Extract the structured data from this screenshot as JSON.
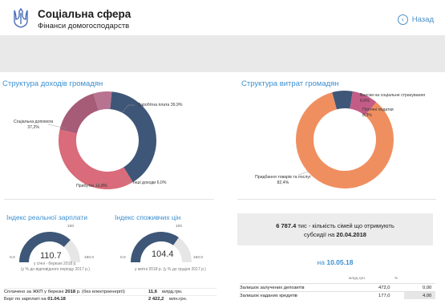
{
  "header": {
    "title": "Соціальна сфера",
    "subtitle": "Фінанси домогосподарств",
    "back_label": "Назад",
    "back_icon": "‹",
    "emblem": "trident-icon"
  },
  "colors": {
    "accent": "#3b8fd0",
    "income_navy": "#3e5778",
    "income_pink": "#d96b7a",
    "income_plum": "#a65b77",
    "expense_orange": "#ef8f5f",
    "expense_plum": "#c35c86",
    "expense_navy": "#3e5778",
    "gauge_fill": "#3e5778",
    "gauge_track": "#e6e6e6"
  },
  "income": {
    "title": "Структура доходів громадян",
    "labels": [
      {
        "name": "Заробітна плата",
        "value": "39,9%"
      },
      {
        "name": "Соціальна допомога",
        "value": "37,2%"
      },
      {
        "name": "Прибуток",
        "value": "16,8%"
      },
      {
        "name": "Інші доходи",
        "value": "6,0%"
      }
    ]
  },
  "expenses": {
    "title": "Структура витрат громадян",
    "labels": [
      {
        "name": "Внески на соціальне страхування",
        "value": "6,6%"
      },
      {
        "name": "Поточні податки",
        "value": "8,3%"
      },
      {
        "name": "Придбання товарів та послуг",
        "value": "82,4%"
      }
    ]
  },
  "chart_data": [
    {
      "type": "pie",
      "title": "Структура доходів громадян",
      "categories": [
        "Заробітна плата",
        "Соціальна допомога",
        "Прибуток",
        "Інші доходи"
      ],
      "values": [
        39.9,
        37.2,
        16.8,
        6.0
      ],
      "colors": [
        "#3e5778",
        "#d96b7a",
        "#a65b77",
        "#b77390"
      ]
    },
    {
      "type": "pie",
      "title": "Структура витрат громадян",
      "categories": [
        "Внески на соціальне страхування",
        "Поточні податки",
        "Придбання товарів та послуг"
      ],
      "values": [
        6.6,
        8.3,
        82.4
      ],
      "colors": [
        "#3e5778",
        "#c35c86",
        "#ef8f5f"
      ]
    }
  ],
  "wage_index": {
    "title": "Індекс реальної зарплати",
    "value": "110.7",
    "level": 110.7,
    "min_label": "0.0",
    "mid_label": "100",
    "max_label": "150.0",
    "caption_line1": "у січні - березні 2018 р.",
    "caption_line2": "(у % до відповідного періоду 2017 р.)"
  },
  "cpi": {
    "title": "Індекс споживчих цін",
    "value": "104.4",
    "level": 104.4,
    "min_label": "0.0",
    "mid_label": "100",
    "max_label": "150.0",
    "caption": "у квітні 2018 р. (у % до грудня 2017 р.)"
  },
  "payments": {
    "row1_prefix": "Сплачено за ЖКП у березні",
    "row1_bold": "2018",
    "row1_suffix": "р. (без електроенергії)",
    "row1_value": "11,6",
    "row1_unit": "млрд.грн.",
    "row2_prefix": "Борг по зарплаті на",
    "row2_bold": "01.04.18",
    "row2_value": "2 422,2",
    "row2_unit": "млн.грн."
  },
  "families": {
    "count": "6 787.4",
    "line1_suffix": "тис - кількість сімей що отримують",
    "line2_prefix": "субсидії на",
    "line2_bold": "20.04.2018"
  },
  "deposits": {
    "date_prefix": "на",
    "date": "10.05.18",
    "col_amount": "млрд.грн.",
    "col_percent": "%",
    "rows": [
      {
        "name": "Залишок залучених депозитів",
        "amount": "472,0",
        "percent": "0,00"
      },
      {
        "name": "Залишок наданих кредитів",
        "amount": "177,0",
        "percent": "4,00"
      }
    ]
  }
}
